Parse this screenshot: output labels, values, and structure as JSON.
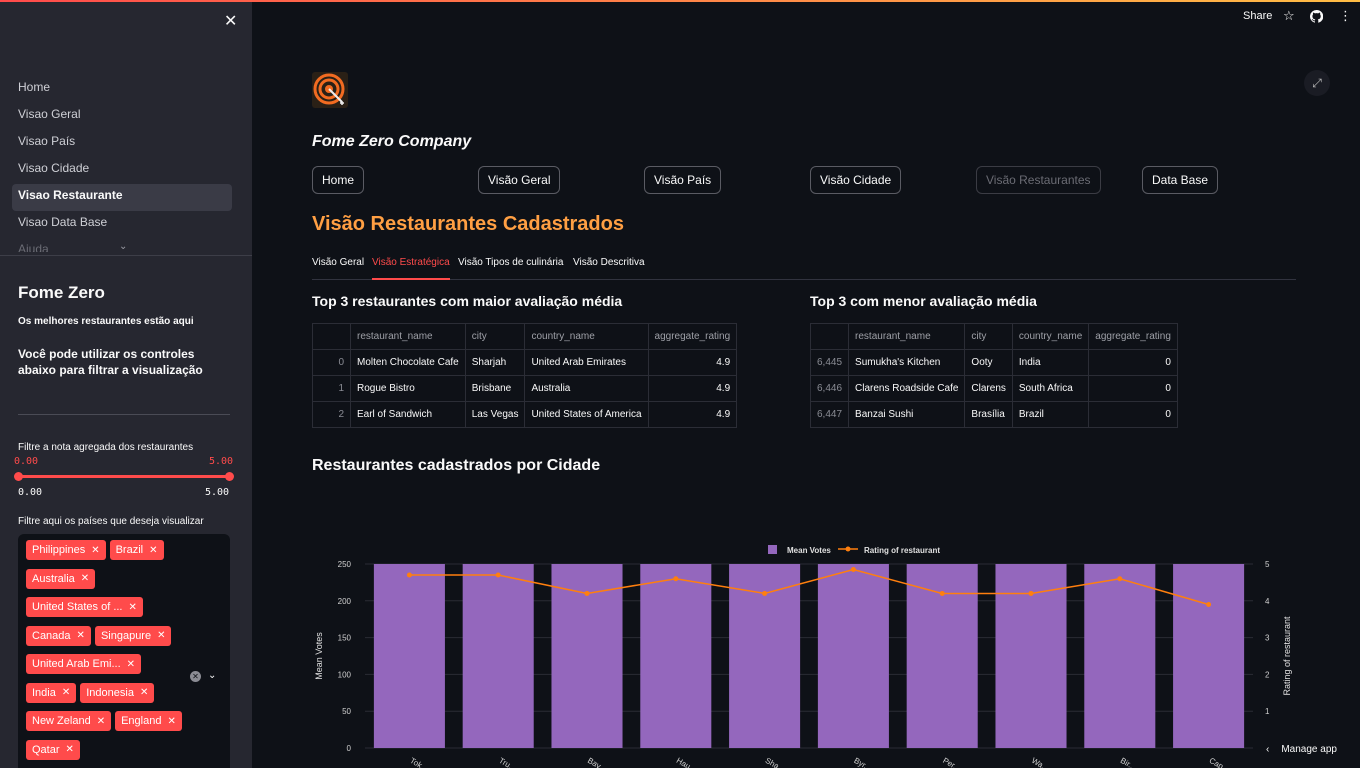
{
  "header": {
    "share_label": "Share",
    "star_icon": "star-icon",
    "github_icon": "github-icon",
    "more_icon": "kebab-menu-icon"
  },
  "sidebar": {
    "nav": [
      {
        "label": "Home"
      },
      {
        "label": "Visao Geral"
      },
      {
        "label": "Visao País"
      },
      {
        "label": "Visao Cidade"
      },
      {
        "label": "Visao Restaurante"
      },
      {
        "label": "Visao Data Base"
      },
      {
        "label": "Ajuda"
      }
    ],
    "title": "Fome Zero",
    "subtitle": "Os melhores restaurantes estão aqui",
    "description": "Você pode utilizar os controles abaixo para filtrar a visualização",
    "slider": {
      "label": "Filtre a nota agregada dos restaurantes",
      "low": "0.00",
      "high": "5.00",
      "min": "0.00",
      "max": "5.00",
      "low_frac": 0.0,
      "high_frac": 1.0
    },
    "countries_label": "Filtre aqui os países que deseja visualizar",
    "countries": [
      "Philippines",
      "Brazil",
      "Australia",
      "United States of ...",
      "Canada",
      "Singapure",
      "United Arab Emi...",
      "India",
      "Indonesia",
      "New Zeland",
      "England",
      "Qatar"
    ]
  },
  "main": {
    "company": "Fome Zero Company",
    "buttons": [
      {
        "label": "Home"
      },
      {
        "label": "Visão Geral"
      },
      {
        "label": "Visão País"
      },
      {
        "label": "Visão Cidade"
      },
      {
        "label": "Visão Restaurantes"
      },
      {
        "label": "Data Base"
      }
    ],
    "title": "Visão Restaurantes Cadastrados",
    "tabs": [
      "Visão Geral",
      "Visão Estratégica",
      "Visão Tipos de culinária",
      "Visão Descritiva"
    ],
    "top_title": "Top 3 restaurantes com maior avaliação média",
    "bottom_title": "Top 3 com menor avaliação média",
    "columns": [
      "",
      "restaurant_name",
      "city",
      "country_name",
      "aggregate_rating"
    ],
    "top_rows": [
      [
        "0",
        "Molten Chocolate Cafe",
        "Sharjah",
        "United Arab Emirates",
        "4.9"
      ],
      [
        "1",
        "Rogue Bistro",
        "Brisbane",
        "Australia",
        "4.9"
      ],
      [
        "2",
        "Earl of Sandwich",
        "Las Vegas",
        "United States of America",
        "4.9"
      ]
    ],
    "bottom_rows": [
      [
        "6,445",
        "Sumukha's Kitchen",
        "Ooty",
        "India",
        "0"
      ],
      [
        "6,446",
        "Clarens Roadside Cafe",
        "Clarens",
        "South Africa",
        "0"
      ],
      [
        "6,447",
        "Banzai Sushi",
        "Brasília",
        "Brazil",
        "0"
      ]
    ],
    "chart_title": "Restaurantes cadastrados por Cidade",
    "manage_app": "Manage app"
  },
  "chart_data": {
    "type": "bar",
    "categories": [
      "Tok...",
      "Tru...",
      "Bav...",
      "Hau...",
      "Sha...",
      "Byr...",
      "Per...",
      "Wa...",
      "Bir...",
      "Cap..."
    ],
    "series": [
      {
        "name": "Mean Votes",
        "type": "bar",
        "axis": "left",
        "values": [
          250,
          250,
          250,
          250,
          250,
          250,
          250,
          250,
          250,
          250
        ],
        "color": "#9467bd"
      },
      {
        "name": "Rating of restaurant",
        "type": "line",
        "axis": "right",
        "values": [
          4.7,
          4.7,
          4.2,
          4.6,
          4.2,
          4.85,
          4.2,
          4.2,
          4.6,
          3.9
        ],
        "color": "#ff7f0e"
      }
    ],
    "ylabel": "Mean Votes",
    "y2label": "Rating of restaurant",
    "ylim": [
      0,
      250
    ],
    "y2lim": [
      0,
      5
    ],
    "yticks": [
      0,
      50,
      100,
      150,
      200,
      250
    ],
    "y2ticks": [
      1,
      2,
      3,
      4,
      5
    ],
    "legend": "top-center"
  }
}
